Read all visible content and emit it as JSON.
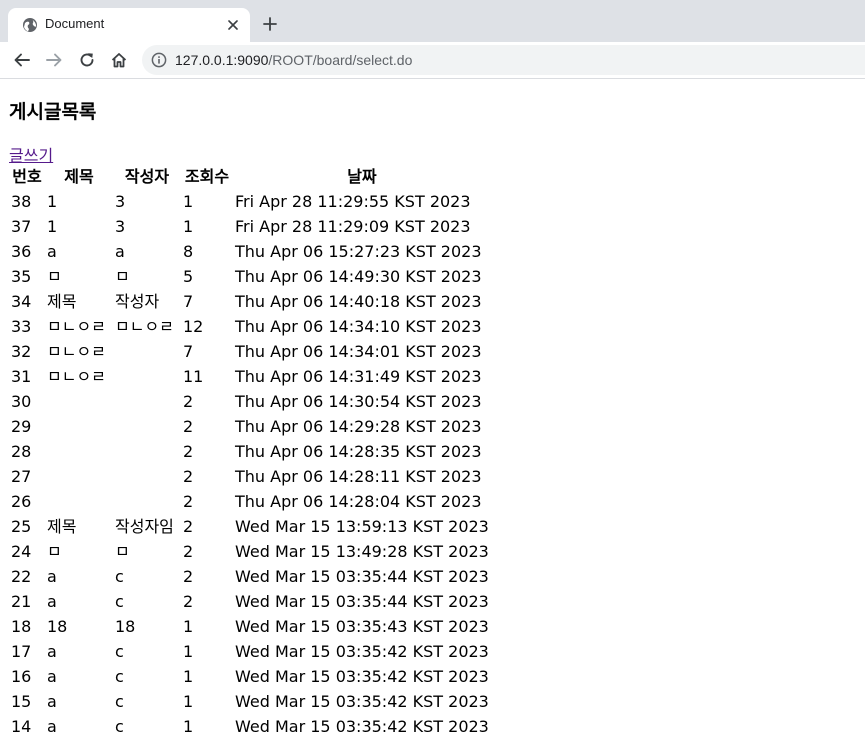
{
  "browser": {
    "tab_title": "Document",
    "url_host": "127.0.0.1:9090",
    "url_path": "/ROOT/board/select.do"
  },
  "page": {
    "heading": "게시글목록",
    "write_link": "글쓰기"
  },
  "table": {
    "headers": [
      "번호",
      "제목",
      "작성자",
      "조회수",
      "날짜"
    ],
    "rows": [
      [
        "38",
        "1",
        "3",
        "1",
        "Fri Apr 28 11:29:55 KST 2023"
      ],
      [
        "37",
        "1",
        "3",
        "1",
        "Fri Apr 28 11:29:09 KST 2023"
      ],
      [
        "36",
        "a",
        "a",
        "8",
        "Thu Apr 06 15:27:23 KST 2023"
      ],
      [
        "35",
        "ㅁ",
        "ㅁ",
        "5",
        "Thu Apr 06 14:49:30 KST 2023"
      ],
      [
        "34",
        "제목",
        "작성자",
        "7",
        "Thu Apr 06 14:40:18 KST 2023"
      ],
      [
        "33",
        "ㅁㄴㅇㄹ",
        "ㅁㄴㅇㄹ",
        "12",
        "Thu Apr 06 14:34:10 KST 2023"
      ],
      [
        "32",
        "ㅁㄴㅇㄹ",
        "",
        "7",
        "Thu Apr 06 14:34:01 KST 2023"
      ],
      [
        "31",
        "ㅁㄴㅇㄹ",
        "",
        "11",
        "Thu Apr 06 14:31:49 KST 2023"
      ],
      [
        "30",
        "",
        "",
        "2",
        "Thu Apr 06 14:30:54 KST 2023"
      ],
      [
        "29",
        "",
        "",
        "2",
        "Thu Apr 06 14:29:28 KST 2023"
      ],
      [
        "28",
        "",
        "",
        "2",
        "Thu Apr 06 14:28:35 KST 2023"
      ],
      [
        "27",
        "",
        "",
        "2",
        "Thu Apr 06 14:28:11 KST 2023"
      ],
      [
        "26",
        "",
        "",
        "2",
        "Thu Apr 06 14:28:04 KST 2023"
      ],
      [
        "25",
        "제목",
        "작성자임",
        "2",
        "Wed Mar 15 13:59:13 KST 2023"
      ],
      [
        "24",
        "ㅁ",
        "ㅁ",
        "2",
        "Wed Mar 15 13:49:28 KST 2023"
      ],
      [
        "22",
        "a",
        "c",
        "2",
        "Wed Mar 15 03:35:44 KST 2023"
      ],
      [
        "21",
        "a",
        "c",
        "2",
        "Wed Mar 15 03:35:44 KST 2023"
      ],
      [
        "18",
        "18",
        "18",
        "1",
        "Wed Mar 15 03:35:43 KST 2023"
      ],
      [
        "17",
        "a",
        "c",
        "1",
        "Wed Mar 15 03:35:42 KST 2023"
      ],
      [
        "16",
        "a",
        "c",
        "1",
        "Wed Mar 15 03:35:42 KST 2023"
      ],
      [
        "15",
        "a",
        "c",
        "1",
        "Wed Mar 15 03:35:42 KST 2023"
      ],
      [
        "14",
        "a",
        "c",
        "1",
        "Wed Mar 15 03:35:42 KST 2023"
      ]
    ]
  },
  "icons": {
    "tab_icon": "globe-icon",
    "close": "close-icon",
    "new_tab": "plus-icon",
    "back": "back-arrow-icon",
    "forward": "forward-arrow-icon",
    "reload": "reload-icon",
    "home": "home-icon",
    "site_info": "info-icon"
  },
  "colors": {
    "tabstrip": "#dee1e6",
    "omnibox": "#f1f3f4",
    "visited_link": "#551a8b"
  }
}
